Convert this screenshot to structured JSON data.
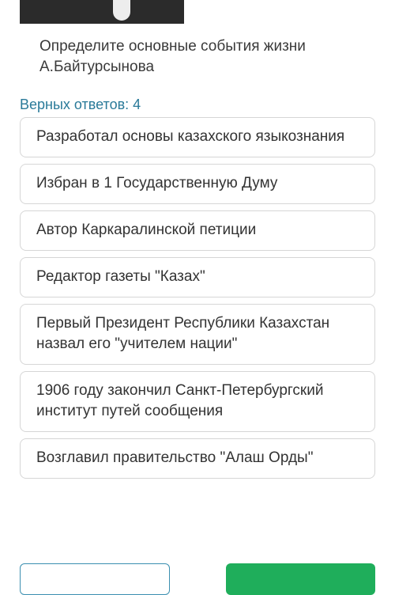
{
  "question": {
    "text": "Определите основные события жизни А.Байтурсынова"
  },
  "correct_answers_label": "Верных ответов: 4",
  "answers": [
    "Разработал основы казахского языкознания",
    "Избран в 1 Государственную Думу",
    "Автор Каркаралинской петиции",
    "Редактор газеты \"Казах\"",
    "Первый Президент Республики Казахстан назвал его \"учителем нации\"",
    "1906 году закончил Санкт-Петербургский институт путей сообщения",
    "Возглавил правительство \"Алаш Орды\""
  ],
  "colors": {
    "accent_text": "#2a7a99",
    "primary_button": "#1fae5b",
    "secondary_button_border": "#3b8fb0"
  }
}
